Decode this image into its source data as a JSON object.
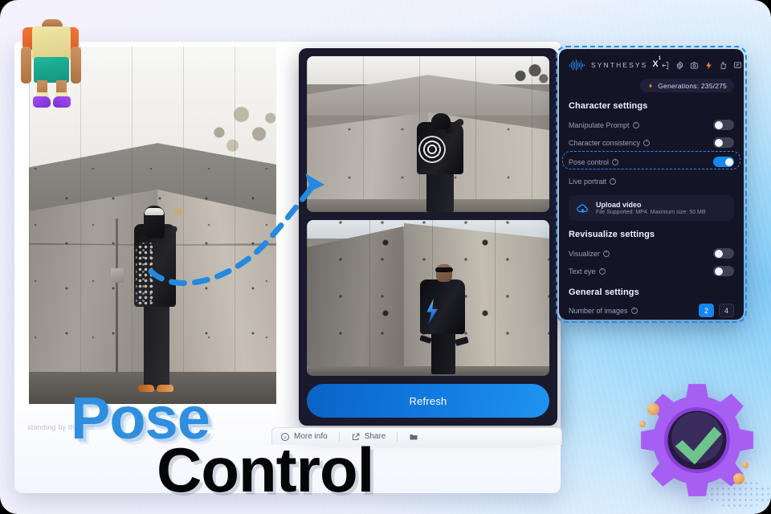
{
  "overlay": {
    "headline_top": "Pose",
    "headline_bottom": "Control"
  },
  "document_sheet": {
    "caption_fragment": "standing by the wall"
  },
  "preview_panel": {
    "refresh_label": "Refresh",
    "image_1_alt": "person in black hoodie with round-print backpack at concrete corner",
    "image_2_alt": "man with sunglasses and blue lightning jacket in front of concrete wall"
  },
  "bottom_toolbar": {
    "items": [
      {
        "label": "More info",
        "icon": "info-circle-icon"
      },
      {
        "label": "Share",
        "icon": "share-icon"
      },
      {
        "label": "",
        "icon": "folder-icon"
      }
    ]
  },
  "dialog": {
    "brand": {
      "name": "SYNTHESYS",
      "suffix": "X",
      "superscript": "1",
      "logo_icon": "audio-waveform-icon"
    },
    "header_icons": [
      "login-arrow-icon",
      "gear-icon",
      "camera-icon",
      "lightning-icon",
      "thumbs-up-icon",
      "chat-bubble-icon",
      "close-icon"
    ],
    "generations": {
      "icon": "lightning-icon",
      "label": "Generations: 235/275",
      "used": 235,
      "total": 275
    },
    "sections": [
      {
        "title": "Character settings",
        "options": [
          {
            "label": "Manipulate Prompt",
            "info_icon": "info-circle-icon",
            "toggle": "off"
          },
          {
            "label": "Character consistency",
            "info_icon": "info-circle-icon",
            "toggle": "off"
          },
          {
            "label": "Pose control",
            "info_icon": "info-circle-icon",
            "toggle": "on",
            "highlighted": true
          },
          {
            "label": "Live portrait",
            "info_icon": "info-circle-icon",
            "toggle": "none"
          }
        ],
        "upload": {
          "icon": "cloud-upload-icon",
          "title": "Upload video",
          "subtitle": "File Supported: MP4. Maximum size: 50 MB"
        }
      },
      {
        "title": "Revisualize settings",
        "options": [
          {
            "label": "Visualizer",
            "info_icon": "info-circle-icon",
            "toggle": "off"
          },
          {
            "label": "Text eye",
            "info_icon": "info-circle-icon",
            "toggle": "off"
          }
        ]
      },
      {
        "title": "General settings",
        "number_of_images": {
          "label": "Number of images",
          "info_icon": "info-circle-icon",
          "options": [
            "2",
            "4"
          ],
          "selected": "2"
        }
      }
    ]
  },
  "decorations": {
    "toy_figure": "3d-character-figure",
    "gear_badge": "gear-with-checkmark-icon",
    "arrow": "dashed-curved-arrow"
  },
  "colors": {
    "accent_blue": "#1587ef",
    "dialog_bg": "#141427",
    "panel_bg": "#1a1a2c",
    "lightning_orange": "#e8832a",
    "headline_blue": "#2f8ede",
    "gear_purple": "#a24ef0",
    "check_green": "#6cc58a"
  }
}
